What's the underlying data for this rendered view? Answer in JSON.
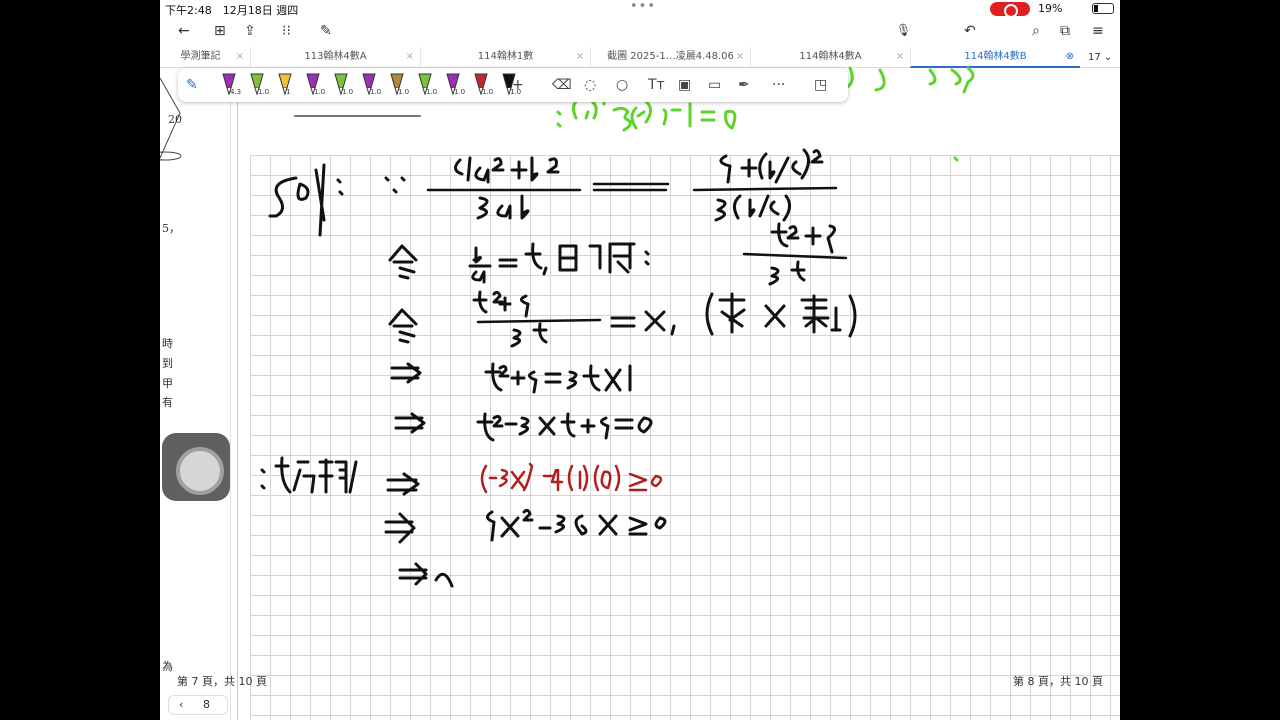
{
  "status": {
    "time": "下午2:48　12月18日 週四",
    "dots": "•••",
    "battery": "19%"
  },
  "toolbar": {
    "back_icon": "←",
    "grid_icon": "⊞",
    "share_icon": "⇪",
    "apps_icon": "⁝⁝",
    "edit_icon": "✎",
    "mic_icon": "🎙",
    "undo_icon": "↶",
    "search_icon": "⌕",
    "copy_icon": "⧉",
    "menu_icon": "≡"
  },
  "tabs": [
    {
      "label": "學測筆記",
      "active": false
    },
    {
      "label": "113翰林4數A",
      "active": false
    },
    {
      "label": "114翰林1數",
      "active": false
    },
    {
      "label": "截圖 2025-1…凌晨4.48.06",
      "active": false
    },
    {
      "label": "114翰林4數A",
      "active": false
    },
    {
      "label": "114翰林4數B",
      "active": true
    }
  ],
  "tab_count": "17 ⌄",
  "pens": [
    {
      "color": "#9b2fb5",
      "size": "4.3"
    },
    {
      "color": "#7fbf3f",
      "size": "1.0"
    },
    {
      "color": "#e8c43a",
      "size": "1"
    },
    {
      "color": "#9b2fb5",
      "size": "1.0"
    },
    {
      "color": "#7fbf3f",
      "size": "1.0"
    },
    {
      "color": "#9b2fb5",
      "size": "1.0"
    },
    {
      "color": "#b08a3a",
      "size": "1.0"
    },
    {
      "color": "#7fbf3f",
      "size": "1.0"
    },
    {
      "color": "#9b2fb5",
      "size": "1.0"
    },
    {
      "color": "#c0282c",
      "size": "1.0"
    },
    {
      "color": "#111111",
      "size": "1.0"
    }
  ],
  "tools": {
    "add": "+",
    "eraser": "⌫",
    "lasso": "◌",
    "shape": "○",
    "text": "Tт",
    "image": "▣",
    "comment": "▭",
    "link": "✒",
    "more": "···",
    "sticker": "◳"
  },
  "left_page": {
    "label_20": "20",
    "label_5": "5，",
    "chars": [
      "時",
      "到",
      "甲",
      "有"
    ],
    "bottom": "為"
  },
  "footer": {
    "left": "第 7 頁，共 10 頁",
    "right": "第 8 頁，共 10 頁"
  },
  "pager": {
    "arrow": "‹",
    "page": "8"
  },
  "colors": {
    "ink": "#111111",
    "red_ink": "#b01e1e",
    "green_ink": "#5ed32c",
    "accent": "#2a6fc9"
  }
}
